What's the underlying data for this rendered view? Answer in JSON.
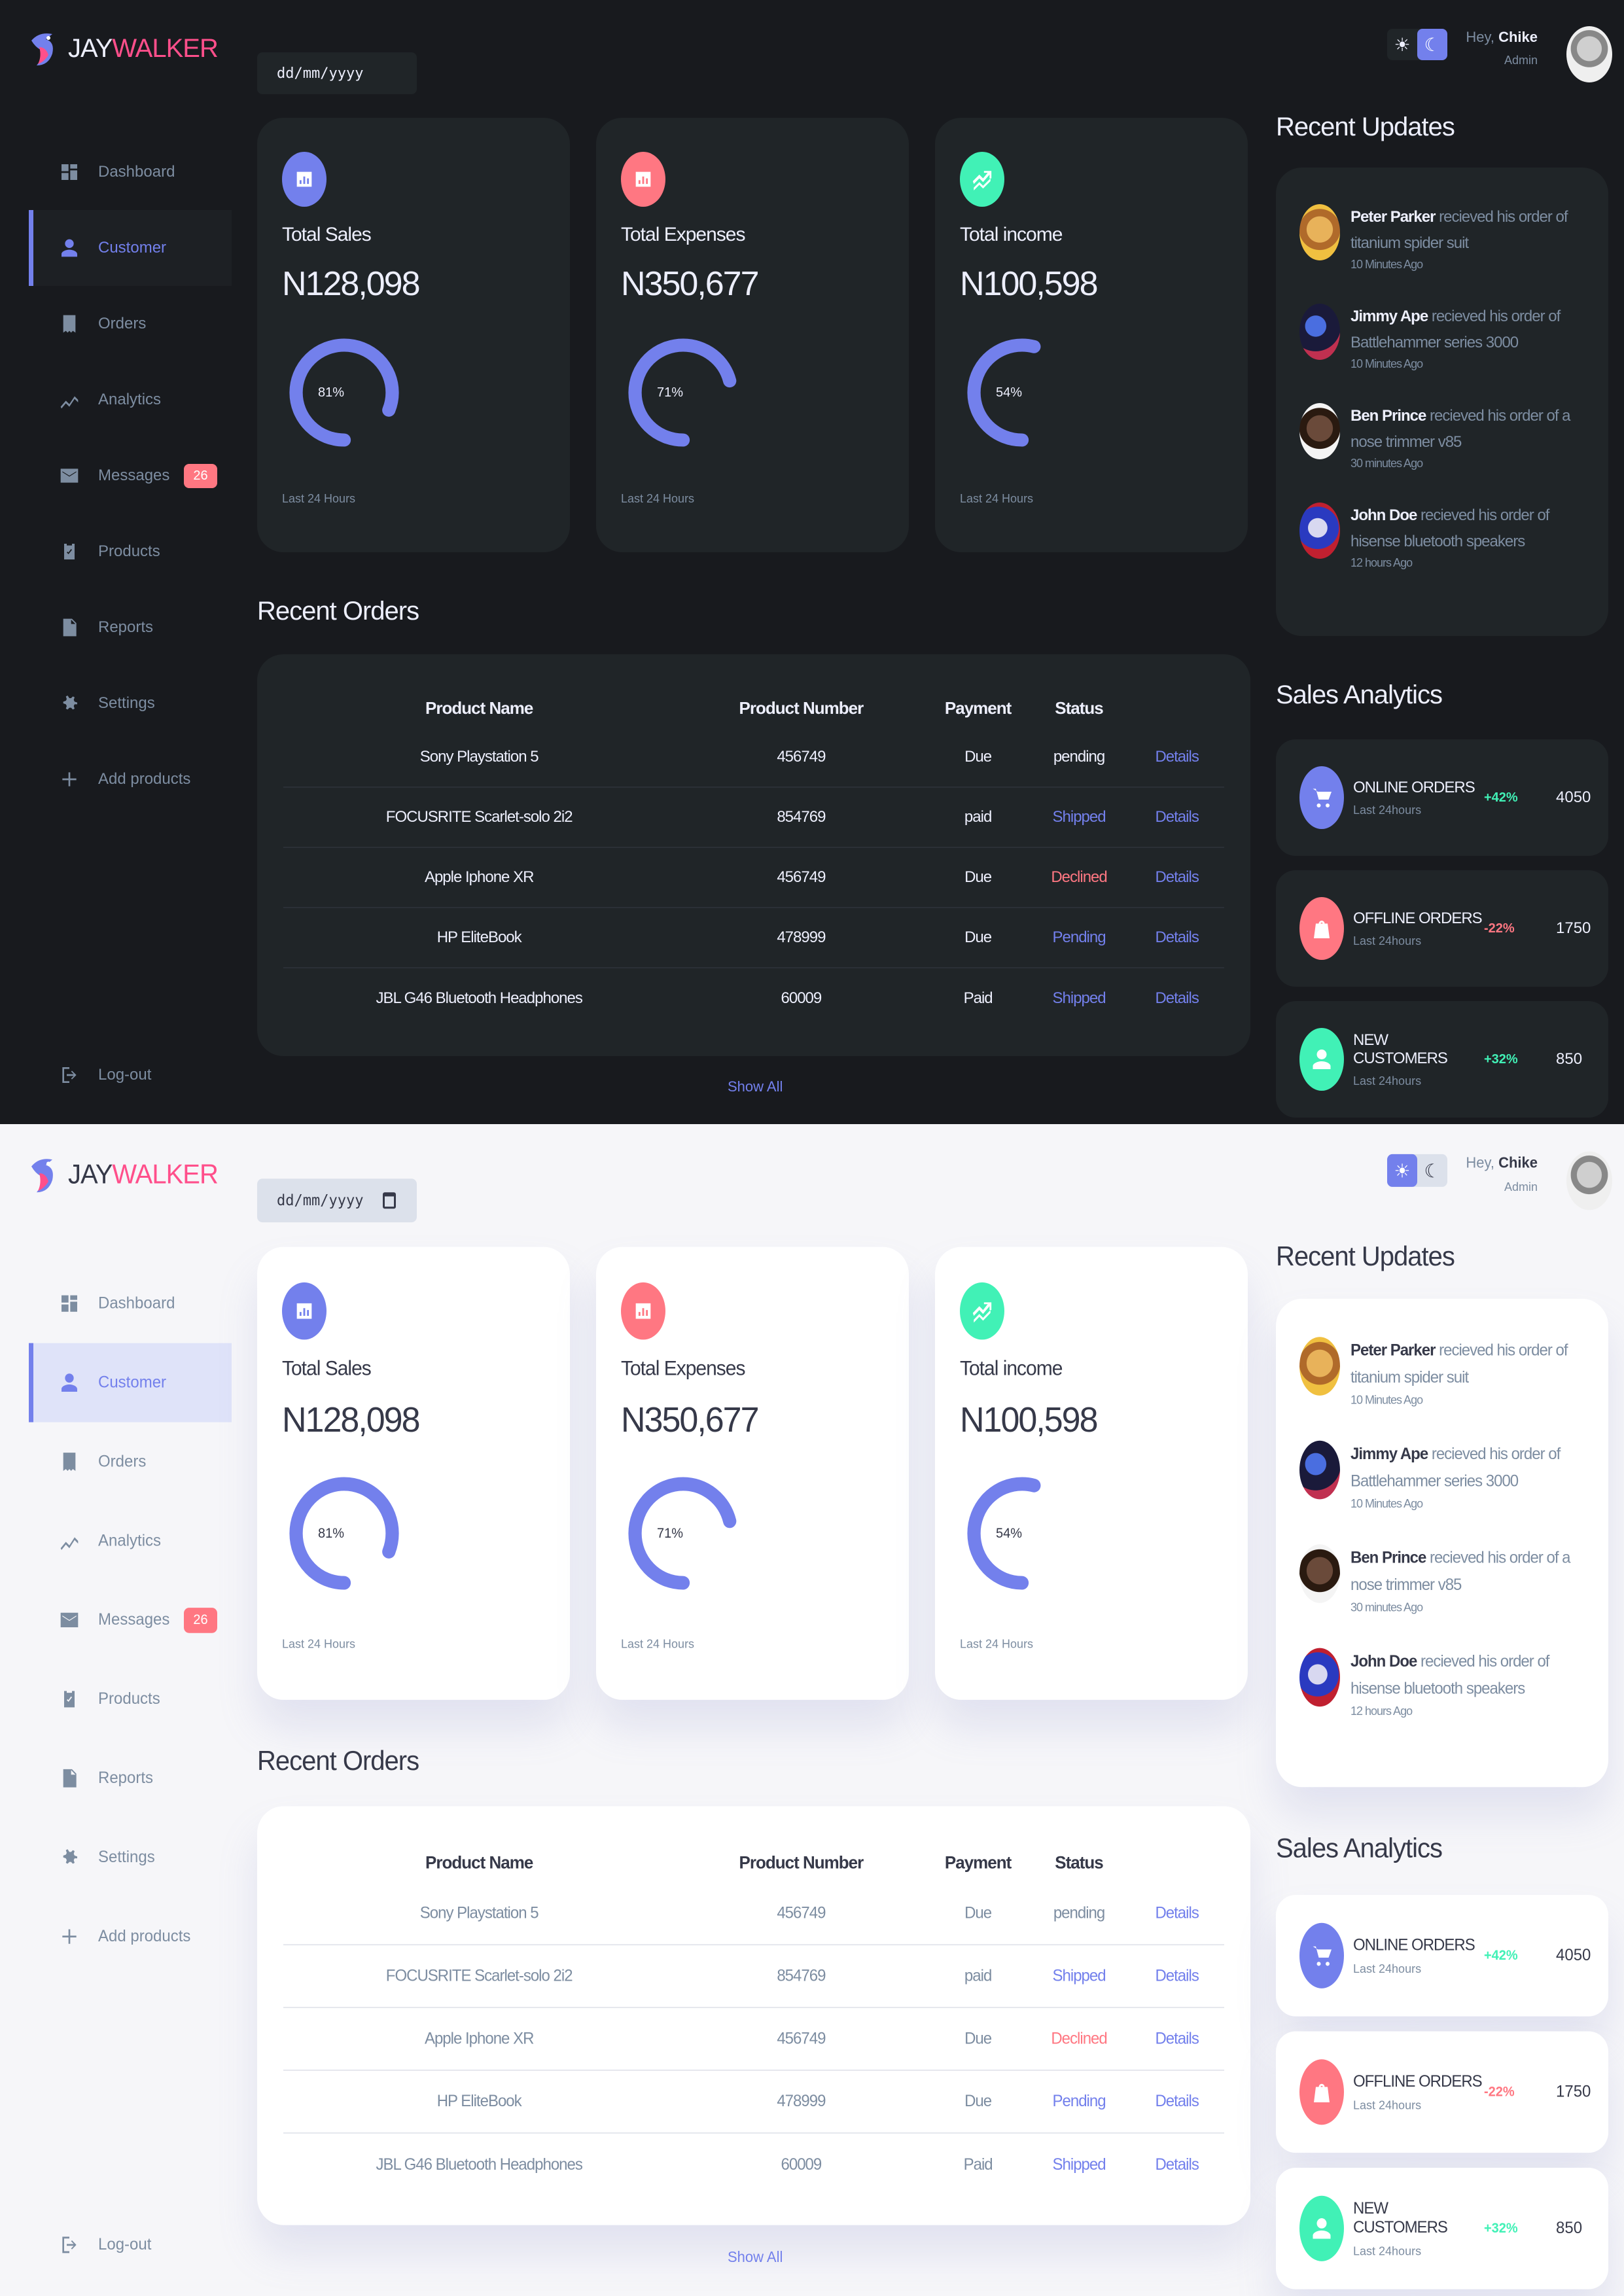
{
  "brand": {
    "part1": "JAY",
    "part2": "WALKER"
  },
  "date_input": {
    "value": "dd/mm/yyyy"
  },
  "header": {
    "greeting": "Hey, ",
    "user": "Chike",
    "role": "Admin"
  },
  "sidebar": {
    "items": [
      {
        "label": "Dashboard",
        "icon": "grid-icon"
      },
      {
        "label": "Customer",
        "icon": "person-icon",
        "active": true
      },
      {
        "label": "Orders",
        "icon": "receipt-icon"
      },
      {
        "label": "Analytics",
        "icon": "insights-icon"
      },
      {
        "label": "Messages",
        "icon": "mail-icon",
        "badge": "26"
      },
      {
        "label": "Products",
        "icon": "inventory-icon"
      },
      {
        "label": "Reports",
        "icon": "report-icon"
      },
      {
        "label": "Settings",
        "icon": "gear-icon"
      },
      {
        "label": "Add products",
        "icon": "plus-icon"
      }
    ],
    "logout": "Log-out"
  },
  "cards": [
    {
      "label": "Total Sales",
      "amount": "N128,098",
      "percent_label": "81%",
      "percent": 81,
      "footer": "Last 24 Hours",
      "color": "#7380ec",
      "icon": "bar-chart-icon"
    },
    {
      "label": "Total Expenses",
      "amount": "N350,677",
      "percent_label": "71%",
      "percent": 71,
      "footer": "Last 24 Hours",
      "color": "#ff7782",
      "icon": "bar-chart-icon"
    },
    {
      "label": "Total income",
      "amount": "N100,598",
      "percent_label": "54%",
      "percent": 54,
      "footer": "Last 24 Hours",
      "color": "#41f1b6",
      "icon": "trending-icon"
    }
  ],
  "orders": {
    "title": "Recent Orders",
    "columns": [
      "Product Name",
      "Product Number",
      "Payment",
      "Status",
      ""
    ],
    "rows": [
      {
        "name": "Sony Playstation 5",
        "number": "456749",
        "payment": "Due",
        "status": "pending",
        "status_color_dark": "#edeffd",
        "status_color_light": "#7d8da1",
        "action": "Details"
      },
      {
        "name": "FOCUSRITE Scarlet-solo 2i2",
        "number": "854769",
        "payment": "paid",
        "status": "Shipped",
        "status_color_dark": "#7380ec",
        "status_color_light": "#7380ec",
        "action": "Details"
      },
      {
        "name": "Apple Iphone XR",
        "number": "456749",
        "payment": "Due",
        "status": "Declined",
        "status_color_dark": "#ff7782",
        "status_color_light": "#ff7782",
        "action": "Details"
      },
      {
        "name": "HP EliteBook",
        "number": "478999",
        "payment": "Due",
        "status": "Pending",
        "status_color_dark": "#7380ec",
        "status_color_light": "#7380ec",
        "action": "Details"
      },
      {
        "name": "JBL G46 Bluetooth Headphones",
        "number": "60009",
        "payment": "Paid",
        "status": "Shipped",
        "status_color_dark": "#7380ec",
        "status_color_light": "#7380ec",
        "action": "Details"
      }
    ],
    "show_all": "Show All"
  },
  "updates": {
    "title": "Recent Updates",
    "items": [
      {
        "name": "Peter Parker",
        "text": " recieved his order of titanium spider suit",
        "time": "10 Minutes Ago"
      },
      {
        "name": "Jimmy Ape",
        "text": " recieved his order of Battlehammer series 3000",
        "time": "10 Minutes Ago"
      },
      {
        "name": "Ben Prince",
        "text": " recieved his order of a nose trimmer v85",
        "time": "30 minutes Ago"
      },
      {
        "name": "John Doe",
        "text": " recieved his order of hisense bluetooth speakers",
        "time": "12 hours Ago"
      }
    ]
  },
  "analytics": {
    "title": "Sales Analytics",
    "items": [
      {
        "label": "ONLINE ORDERS",
        "sub": "Last 24hours",
        "change": "+42%",
        "value": "4050",
        "trend": "up",
        "color": "#7380ec",
        "icon": "cart-icon"
      },
      {
        "label": "OFFLINE ORDERS",
        "sub": "Last 24hours",
        "change": "-22%",
        "value": "1750",
        "trend": "down",
        "color": "#ff7782",
        "icon": "bag-icon"
      },
      {
        "label": "NEW CUSTOMERS",
        "sub": "Last 24hours",
        "change": "+32%",
        "value": "850",
        "trend": "up",
        "color": "#41f1b6",
        "icon": "person-icon"
      }
    ]
  }
}
